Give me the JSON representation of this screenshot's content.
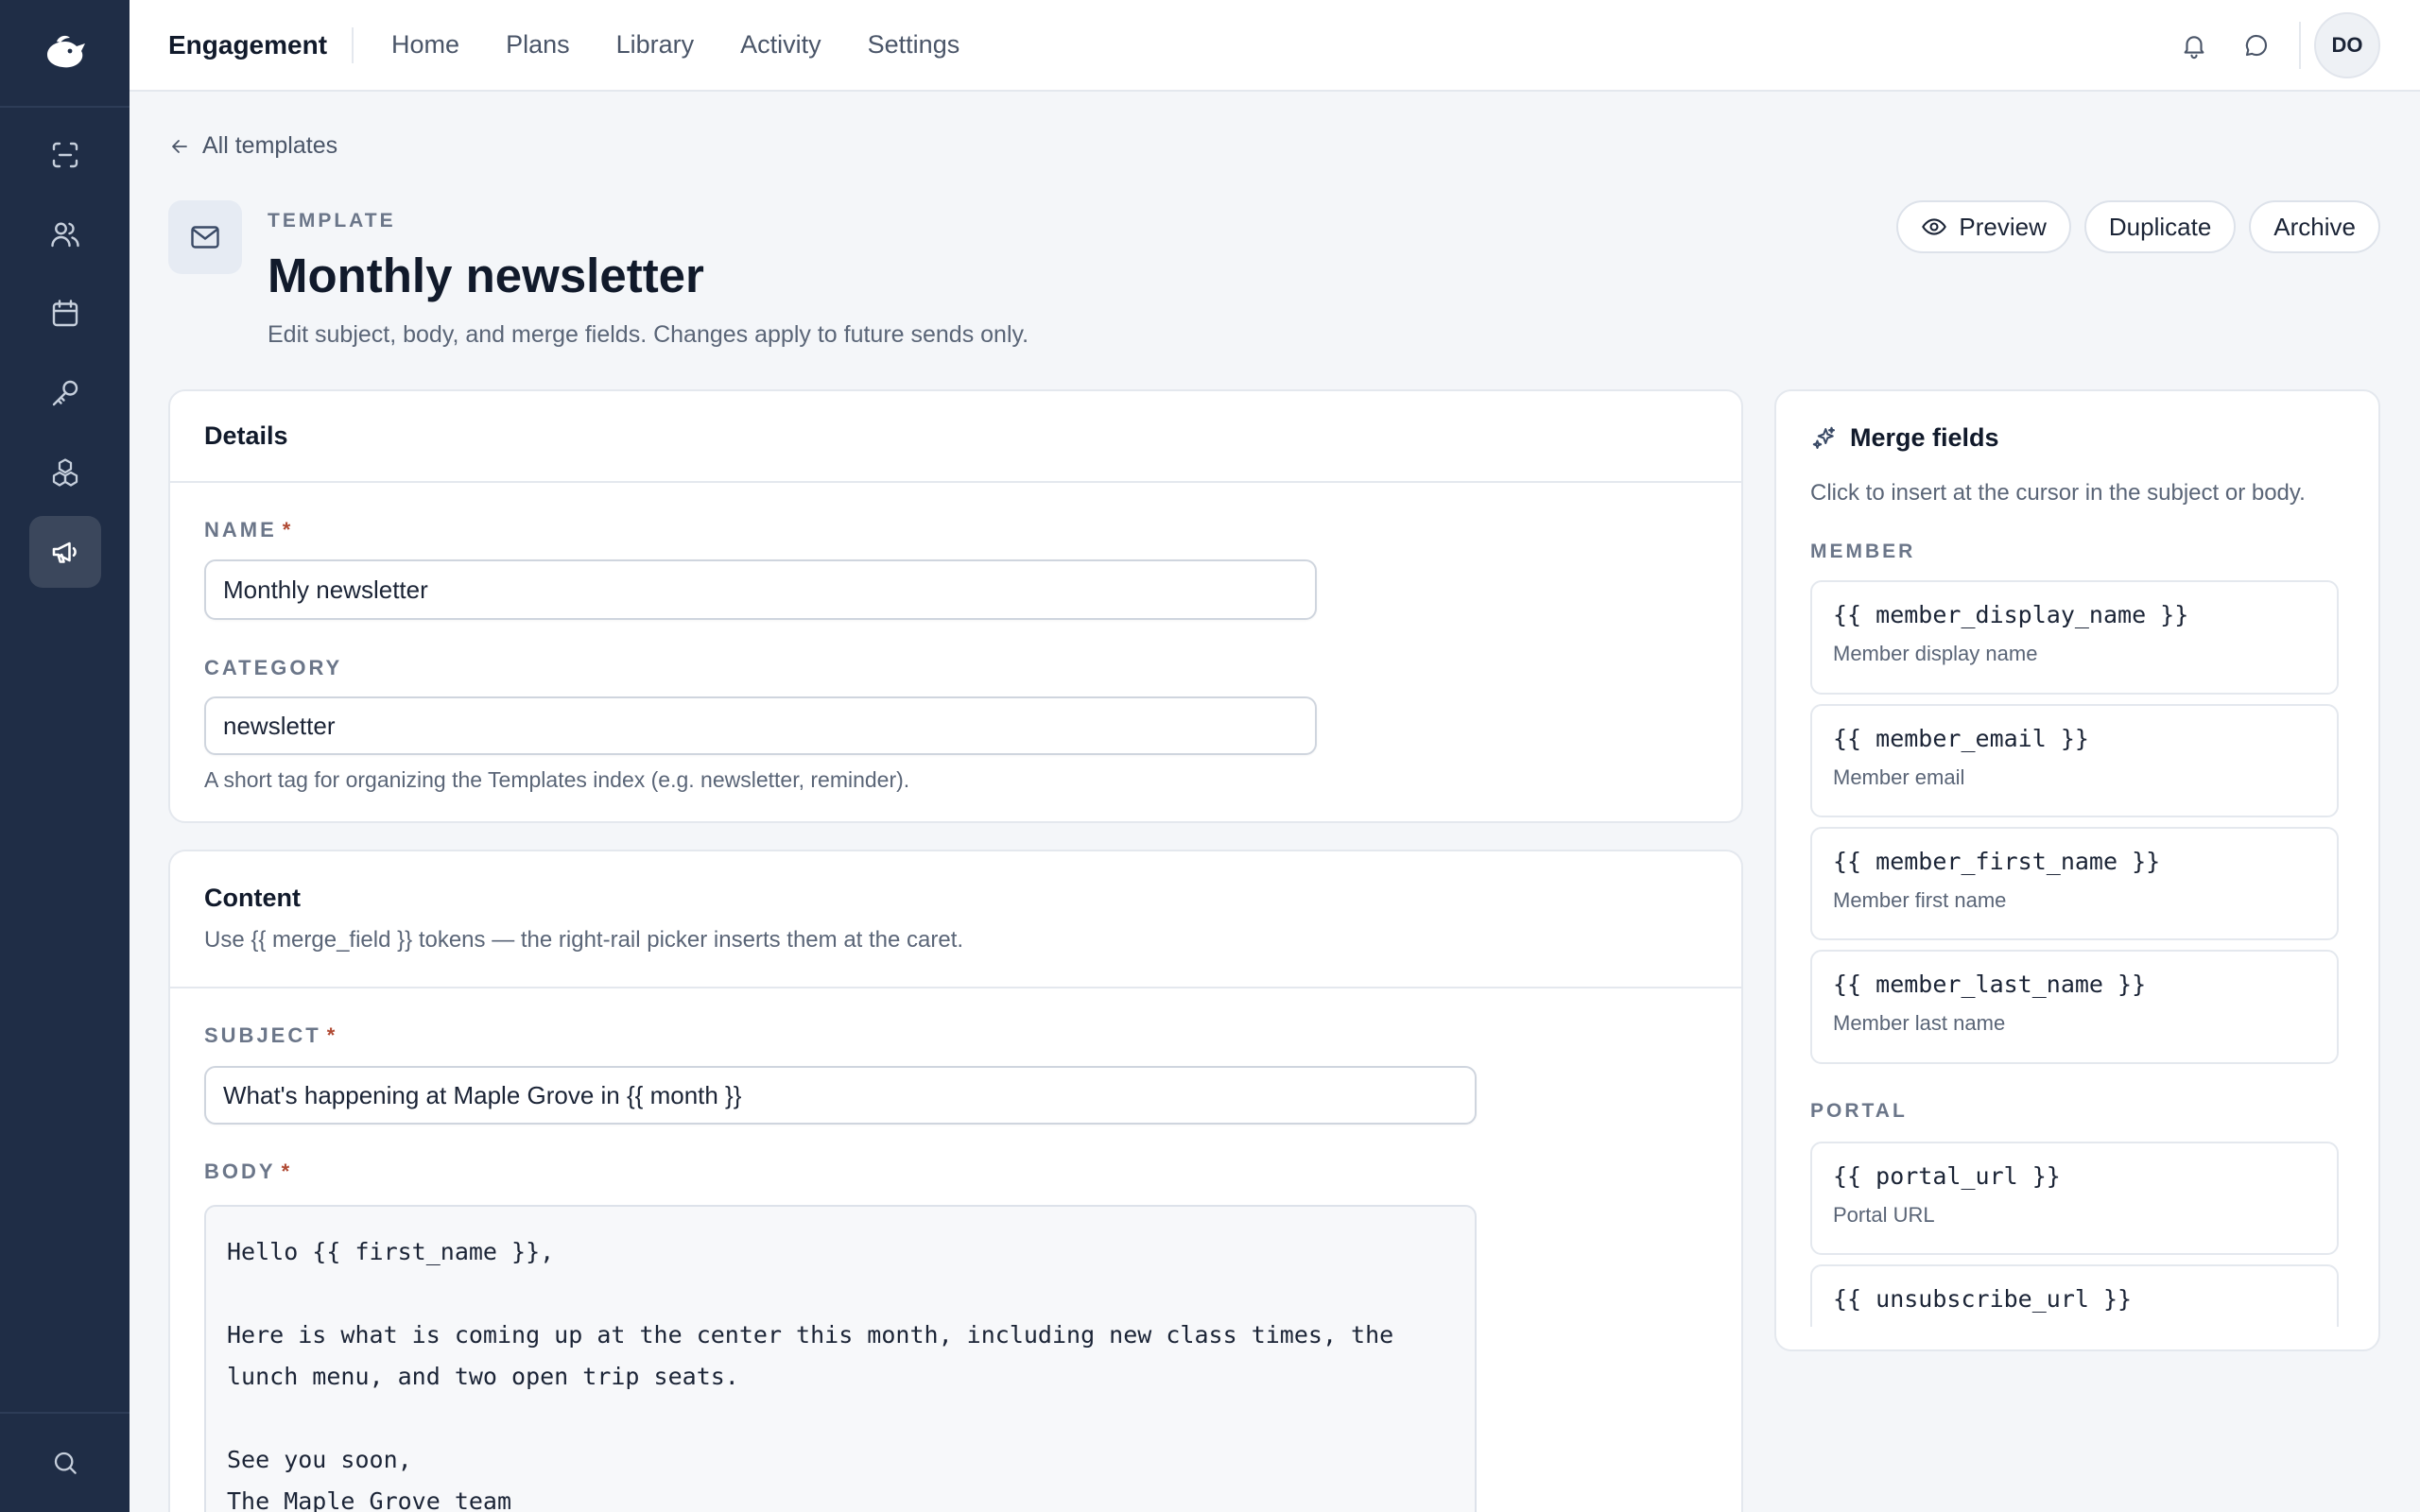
{
  "app": {
    "title": "Engagement",
    "nav": [
      "Home",
      "Plans",
      "Library",
      "Activity",
      "Settings"
    ],
    "avatar_initials": "DO"
  },
  "rail": {
    "items": [
      "scan-icon",
      "users-icon",
      "calendar-icon",
      "key-icon",
      "boxes-icon",
      "megaphone-icon"
    ],
    "active": "megaphone-icon"
  },
  "breadcrumb": {
    "label": "All templates"
  },
  "header": {
    "eyebrow": "TEMPLATE",
    "title": "Monthly newsletter",
    "subtitle": "Edit subject, body, and merge fields. Changes apply to future sends only.",
    "actions": {
      "preview": "Preview",
      "duplicate": "Duplicate",
      "archive": "Archive"
    }
  },
  "details": {
    "title": "Details",
    "name_label": "NAME",
    "name_value": "Monthly newsletter",
    "category_label": "CATEGORY",
    "category_value": "newsletter",
    "category_help": "A short tag for organizing the Templates index (e.g. newsletter, reminder)."
  },
  "content": {
    "title": "Content",
    "description": "Use {{ merge_field }} tokens — the right-rail picker inserts them at the caret.",
    "subject_label": "SUBJECT",
    "subject_value": "What's happening at Maple Grove in {{ month }}",
    "body_label": "BODY",
    "body_value": "Hello {{ first_name }},\n\nHere is what is coming up at the center this month, including new class times, the\nlunch menu, and two open trip seats.\n\nSee you soon,\nThe Maple Grove team"
  },
  "required_mark": "*",
  "merge_fields": {
    "title": "Merge fields",
    "description": "Click to insert at the cursor in the subject or body.",
    "groups": [
      {
        "name": "MEMBER",
        "items": [
          {
            "token": "{{ member_display_name }}",
            "label": "Member display name"
          },
          {
            "token": "{{ member_email }}",
            "label": "Member email"
          },
          {
            "token": "{{ member_first_name }}",
            "label": "Member first name"
          },
          {
            "token": "{{ member_last_name }}",
            "label": "Member last name"
          }
        ]
      },
      {
        "name": "PORTAL",
        "items": [
          {
            "token": "{{ portal_url }}",
            "label": "Portal URL"
          },
          {
            "token": "{{ unsubscribe_url }}",
            "label": ""
          }
        ]
      }
    ]
  },
  "colors": {
    "rail": "#1f2d46",
    "accent": "#111a2b",
    "required": "#b04a33"
  }
}
